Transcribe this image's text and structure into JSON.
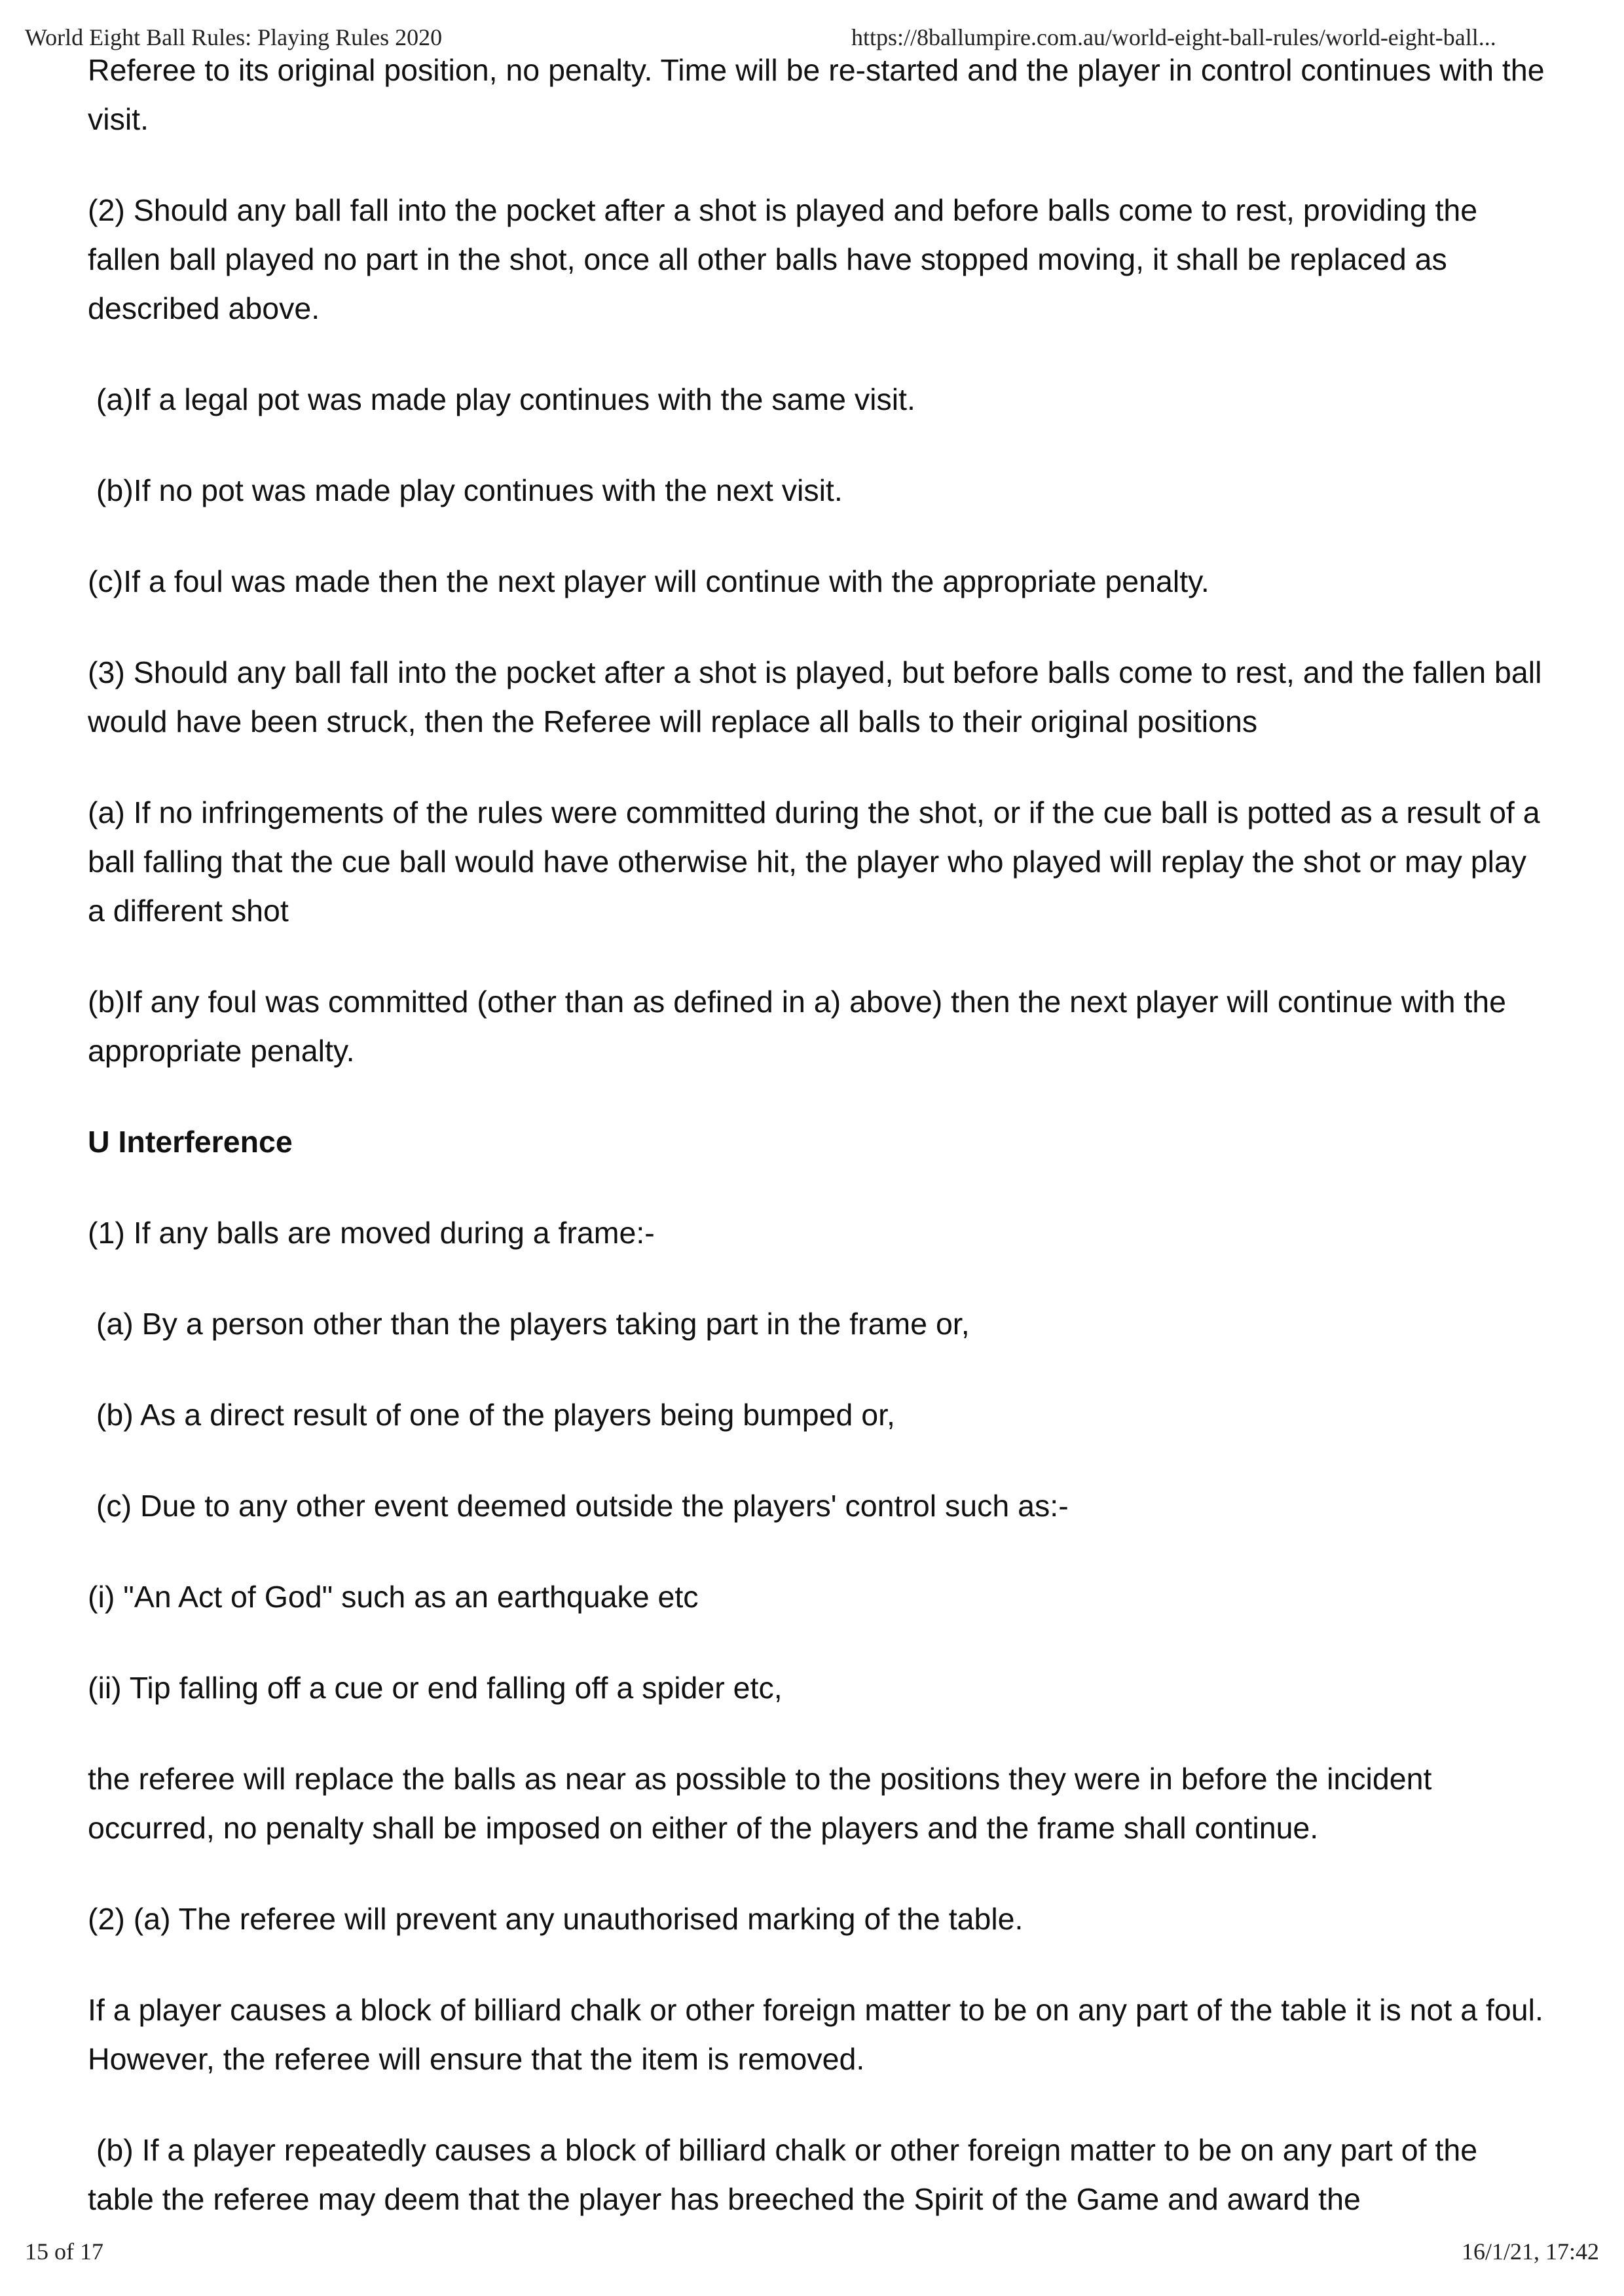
{
  "header": {
    "title": "World Eight Ball Rules: Playing Rules 2020",
    "url": "https://8ballumpire.com.au/world-eight-ball-rules/world-eight-ball..."
  },
  "paragraphs": [
    "Referee to its original position, no penalty. Time will be re-started and the player in control continues with the visit.",
    "(2) Should any ball fall into the pocket after a shot is played and before balls come to rest, providing the fallen ball played no part in the shot, once all other balls have stopped moving, it shall be replaced as described above.",
    " (a)If a legal pot was made play continues with the same visit.",
    " (b)If no pot was made play continues with the next visit.",
    "(c)If a foul was made then the next player will continue with the appropriate penalty.",
    "(3) Should any ball fall into the pocket after a shot is played, but before balls come to rest, and the fallen ball would have been struck, then the Referee will replace all balls to their original positions",
    "(a) If no infringements of the rules were committed during the shot, or if the cue ball is potted as a result of a ball falling that the cue ball would have otherwise hit, the player who played will replay the shot or may play a different shot",
    "(b)If any foul was committed (other than as defined in a) above) then the next player will continue with the appropriate penalty.",
    "U Interference",
    "(1) If any balls are moved during a frame:-",
    " (a) By a person other than the players taking part in the frame or,",
    " (b) As a direct result of one of the players being bumped or,",
    " (c) Due to any other event deemed outside the players' control such as:-",
    "(i) \"An Act of God\" such as an earthquake etc",
    "(ii) Tip falling off a cue or end falling off a spider etc,",
    "the referee will replace the balls as near as possible to the positions they were in before the incident occurred, no penalty shall be imposed on either of the players and the frame shall continue.",
    "(2) (a) The referee will prevent any unauthorised marking of the table.",
    "If a player causes a block of billiard chalk or other foreign matter to be on any part of the table it is not a foul. However, the referee will ensure that the item is removed.",
    " (b) If a player repeatedly causes a block of billiard chalk or other foreign matter to be on any part of the table the referee may deem that the player has breeched the Spirit of the Game and award the"
  ],
  "footer": {
    "page": "15 of 17",
    "datetime": "16/1/21, 17:42"
  }
}
